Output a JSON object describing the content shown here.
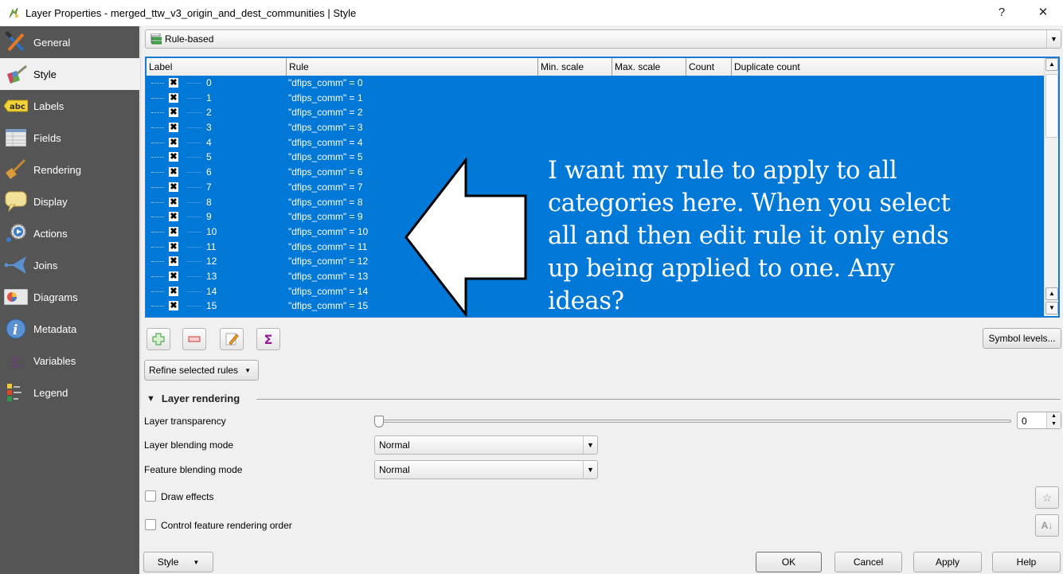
{
  "window": {
    "title": "Layer Properties - merged_ttw_v3_origin_and_dest_communities | Style",
    "help_label": "?",
    "close_label": "✕"
  },
  "sidebar": {
    "items": [
      {
        "label": "General",
        "icon": "tools-icon",
        "active": false
      },
      {
        "label": "Style",
        "icon": "paintbrush-icon",
        "active": true
      },
      {
        "label": "Labels",
        "icon": "labels-abc-icon",
        "active": false
      },
      {
        "label": "Fields",
        "icon": "table-icon",
        "active": false
      },
      {
        "label": "Rendering",
        "icon": "brush-icon",
        "active": false
      },
      {
        "label": "Display",
        "icon": "speech-bubble-icon",
        "active": false
      },
      {
        "label": "Actions",
        "icon": "gear-play-icon",
        "active": false
      },
      {
        "label": "Joins",
        "icon": "join-arrow-icon",
        "active": false
      },
      {
        "label": "Diagrams",
        "icon": "pie-diagram-icon",
        "active": false
      },
      {
        "label": "Metadata",
        "icon": "info-icon",
        "active": false
      },
      {
        "label": "Variables",
        "icon": "epsilon-icon",
        "active": false
      },
      {
        "label": "Legend",
        "icon": "legend-icon",
        "active": false
      }
    ]
  },
  "renderer": {
    "selected": "Rule-based"
  },
  "rules_table": {
    "columns": [
      "Label",
      "Rule",
      "Min. scale",
      "Max. scale",
      "Count",
      "Duplicate count"
    ],
    "rows": [
      {
        "label": "0",
        "rule": "\"dfips_comm\" = 0"
      },
      {
        "label": "1",
        "rule": "\"dfips_comm\" = 1"
      },
      {
        "label": "2",
        "rule": "\"dfips_comm\" = 2"
      },
      {
        "label": "3",
        "rule": "\"dfips_comm\" = 3"
      },
      {
        "label": "4",
        "rule": "\"dfips_comm\" = 4"
      },
      {
        "label": "5",
        "rule": "\"dfips_comm\" = 5"
      },
      {
        "label": "6",
        "rule": "\"dfips_comm\" = 6"
      },
      {
        "label": "7",
        "rule": "\"dfips_comm\" = 7"
      },
      {
        "label": "8",
        "rule": "\"dfips_comm\" = 8"
      },
      {
        "label": "9",
        "rule": "\"dfips_comm\" = 9"
      },
      {
        "label": "10",
        "rule": "\"dfips_comm\" = 10"
      },
      {
        "label": "11",
        "rule": "\"dfips_comm\" = 11"
      },
      {
        "label": "12",
        "rule": "\"dfips_comm\" = 12"
      },
      {
        "label": "13",
        "rule": "\"dfips_comm\" = 13"
      },
      {
        "label": "14",
        "rule": "\"dfips_comm\" = 14"
      },
      {
        "label": "15",
        "rule": "\"dfips_comm\" = 15"
      }
    ],
    "checkbox_mark": "✖"
  },
  "annotation": {
    "text": "I want my rule to apply to all categories here. When you select all and then edit rule it only ends up being applied to one. Any ideas?"
  },
  "toolbar": {
    "add_label": "+",
    "remove_label": "−",
    "edit_label": "✎",
    "sum_label": "Σ",
    "symbol_levels_label": "Symbol levels...",
    "refine_label": "Refine selected rules"
  },
  "layer_rendering": {
    "section_title": "Layer rendering",
    "transparency_label": "Layer transparency",
    "transparency_value": "0",
    "transparency_percent": 0,
    "layer_blending_label": "Layer blending mode",
    "layer_blending_value": "Normal",
    "feature_blending_label": "Feature blending mode",
    "feature_blending_value": "Normal",
    "draw_effects_label": "Draw effects",
    "draw_effects_checked": false,
    "control_order_label": "Control feature rendering order",
    "control_order_checked": false
  },
  "footer": {
    "style_label": "Style",
    "ok_label": "OK",
    "cancel_label": "Cancel",
    "apply_label": "Apply",
    "help_label": "Help"
  },
  "colors": {
    "selection": "#0078d7",
    "sidebar_bg": "#555555",
    "dialog_bg": "#f0f0f0"
  }
}
